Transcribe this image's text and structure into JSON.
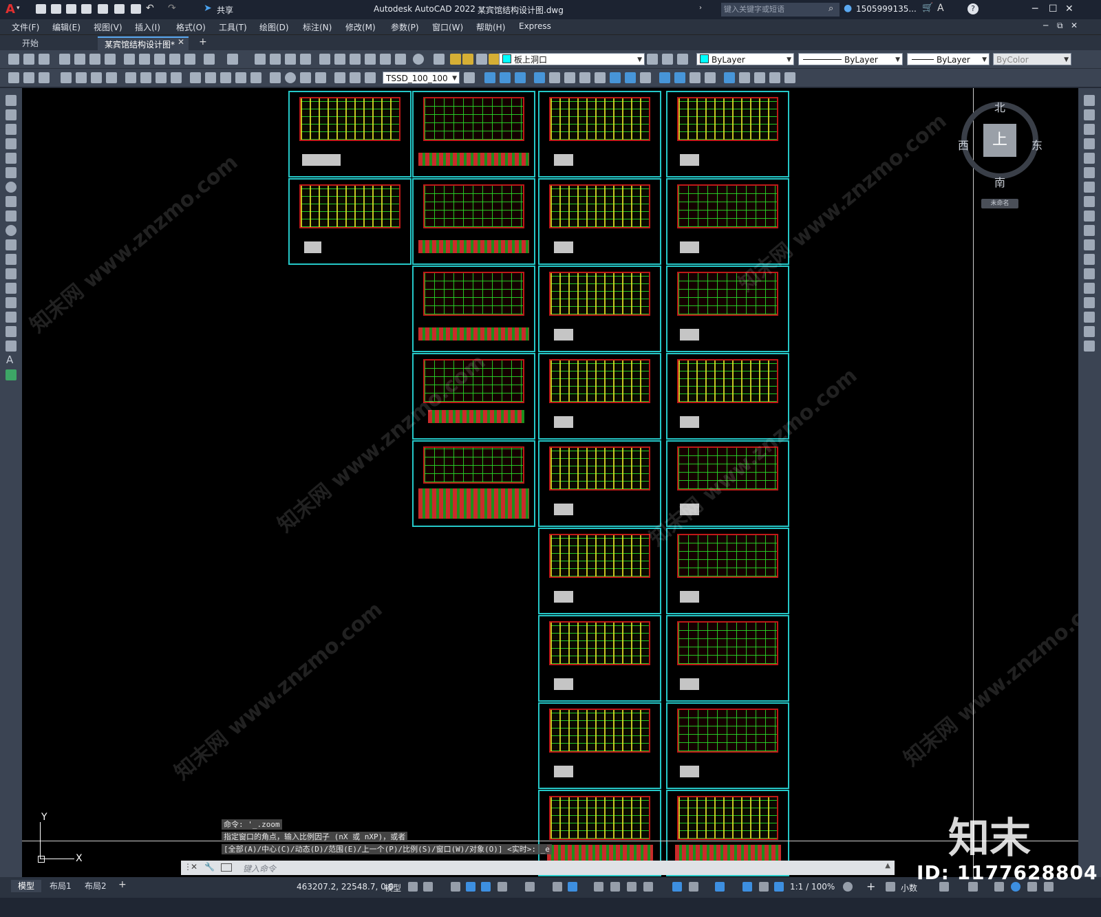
{
  "titlebar": {
    "app_title": "Autodesk AutoCAD 2022",
    "file_title": "某宾馆结构设计图.dwg",
    "share_label": "共享",
    "search_placeholder": "键入关键字或短语",
    "user": "1505999135...",
    "help": "?"
  },
  "menu": [
    "文件(F)",
    "编辑(E)",
    "视图(V)",
    "插入(I)",
    "格式(O)",
    "工具(T)",
    "绘图(D)",
    "标注(N)",
    "修改(M)",
    "参数(P)",
    "窗口(W)",
    "帮助(H)",
    "Express"
  ],
  "tabs": [
    {
      "label": "开始"
    },
    {
      "label": "某宾馆结构设计图*"
    }
  ],
  "toolbar": {
    "layer": "板上洞口",
    "color": "ByLayer",
    "linetype": "ByLayer",
    "lineweight": "ByLayer",
    "plotstyle": "ByColor",
    "dimstyle": "TSSD_100_100"
  },
  "viewcube": {
    "north": "北",
    "south": "南",
    "east": "东",
    "west": "西",
    "top": "上",
    "wcs": "未命名"
  },
  "ucs": {
    "y": "Y",
    "x": "X"
  },
  "command": {
    "line1": "命令: '_.zoom",
    "line2": "指定窗口的角点，输入比例因子 (nX 或 nXP)，或者",
    "line3": "[全部(A)/中心(C)/动态(D)/范围(E)/上一个(P)/比例(S)/窗口(W)/对象(O)] <实时>: _e",
    "placeholder": "键入命令"
  },
  "layout_tabs": [
    "模型",
    "布局1",
    "布局2"
  ],
  "status": {
    "coords": "463207.2, 22548.7, 0.0",
    "model": "模型",
    "scale": "1:1 / 100%",
    "units": "小数"
  },
  "watermark": {
    "brand": "知末",
    "id": "ID: 1177628804",
    "site": "知末网 www.znzmo.com"
  }
}
